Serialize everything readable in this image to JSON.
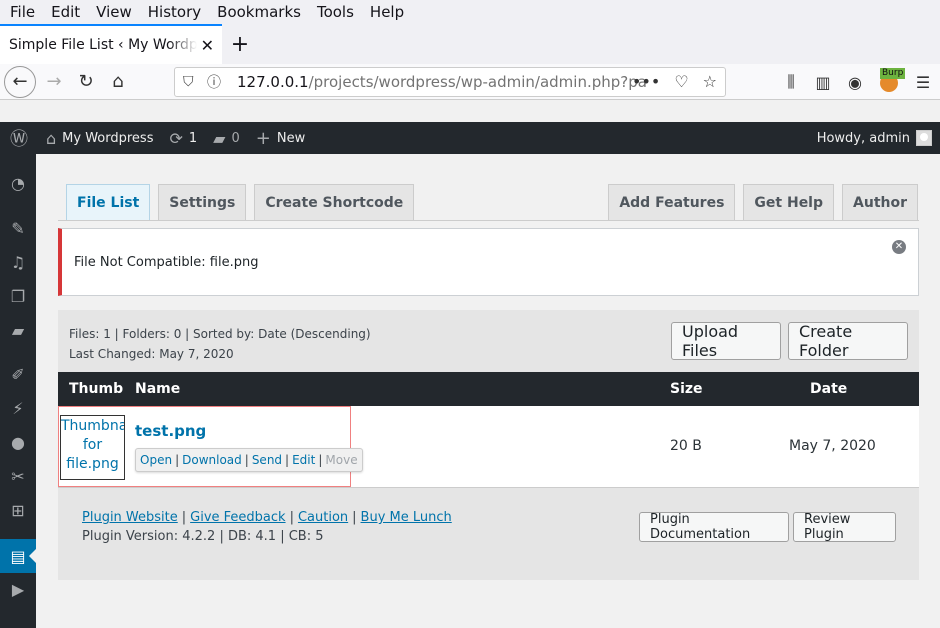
{
  "browser": {
    "menu": [
      "File",
      "Edit",
      "View",
      "History",
      "Bookmarks",
      "Tools",
      "Help"
    ],
    "tab_title": "Simple File List ‹ My Wordpress — WordPress",
    "url_host": "127.0.0.1",
    "url_path": "/projects/wordpress/wp-admin/admin.php?page=ee-simple-file-list",
    "burp_label": "Burp"
  },
  "adminbar": {
    "site_name": "My Wordpress",
    "updates_count": "1",
    "comments_count": "0",
    "new_label": "New",
    "howdy": "Howdy, admin"
  },
  "tabs": {
    "left": [
      "File List",
      "Settings",
      "Create Shortcode"
    ],
    "right": [
      "Add Features",
      "Get Help",
      "Author"
    ]
  },
  "notice": {
    "message": "File Not Compatible: file.png"
  },
  "listing": {
    "meta_line1": "Files: 1 | Folders: 0 | Sorted by: Date (Descending)",
    "meta_line2": "Last Changed: May 7, 2020",
    "upload_button": "Upload Files",
    "create_folder_button": "Create Folder",
    "columns": {
      "thumb": "Thumb",
      "name": "Name",
      "size": "Size",
      "date": "Date"
    },
    "rows": [
      {
        "thumb_alt": "Thumbnail for file.png",
        "name": "test.png",
        "size": "20 B",
        "date": "May 7, 2020",
        "actions": [
          "Open",
          "Download",
          "Send",
          "Edit",
          "Move"
        ]
      }
    ]
  },
  "footer": {
    "links": [
      "Plugin Website",
      "Give Feedback",
      "Caution",
      "Buy Me Lunch"
    ],
    "version_line": "Plugin Version: 4.2.2 | DB: 4.1 | CB: 5",
    "doc_button": "Plugin Documentation",
    "review_button": "Review Plugin"
  }
}
